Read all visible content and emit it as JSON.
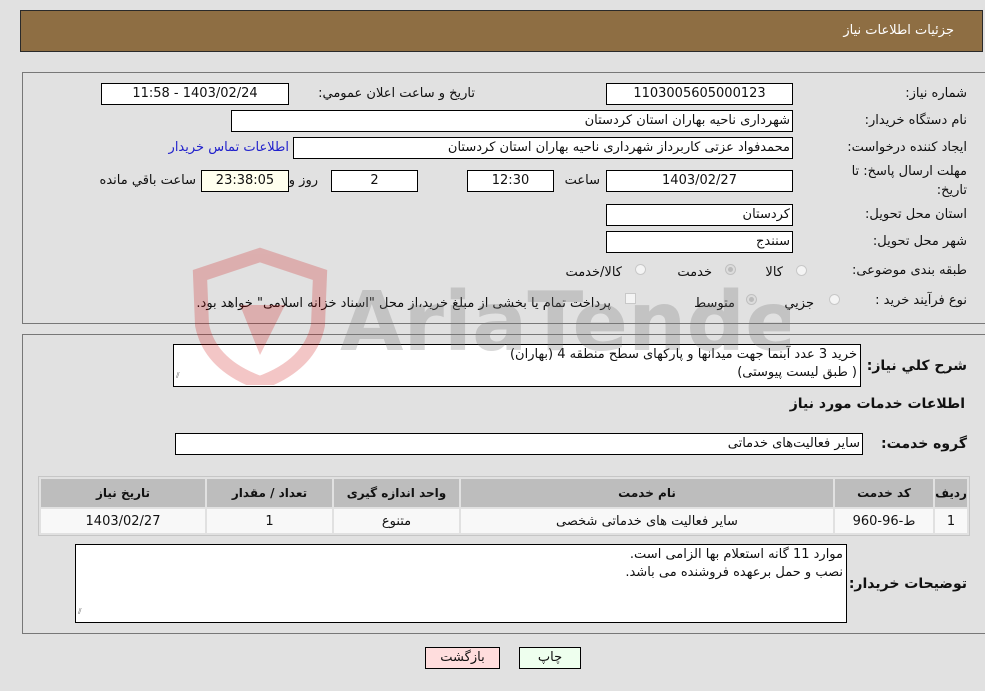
{
  "header": {
    "title": "جزئیات اطلاعات نیاز"
  },
  "fields": {
    "need_number_label": "شماره نیاز:",
    "need_number": "1103005605000123",
    "announce_label": "تاریخ و ساعت اعلان عمومي:",
    "announce_value": "1403/02/24 - 11:58",
    "buyer_org_label": "نام دستگاه خریدار:",
    "buyer_org": "شهرداری ناحیه بهاران استان کردستان",
    "creator_label": "ایجاد کننده درخواست:",
    "creator": "محمدفواد عزتی کاربرداز شهرداری ناحیه بهاران استان کردستان",
    "contact_link": "اطلاعات تماس خریدار",
    "deadline_label_1": "مهلت ارسال پاسخ: تا",
    "deadline_label_2": "تاریخ:",
    "deadline_date": "1403/02/27",
    "time_label": "ساعت",
    "deadline_time": "12:30",
    "days_value": "2",
    "days_label": "روز و",
    "remaining_time": "23:38:05",
    "remaining_label": "ساعت باقي مانده",
    "province_label": "استان محل تحویل:",
    "province": "کردستان",
    "city_label": "شهر محل تحویل:",
    "city": "سنندج",
    "category_label": "طبقه بندی موضوعی:",
    "category_options": [
      {
        "label": "کالا",
        "checked": false
      },
      {
        "label": "خدمت",
        "checked": true
      },
      {
        "label": "کالا/خدمت",
        "checked": false
      }
    ],
    "process_label": "نوع فرآیند خرید :",
    "process_options": [
      {
        "label": "جزيي",
        "checked": false
      },
      {
        "label": "متوسط",
        "checked": true
      }
    ],
    "treasury_note": "پرداخت تمام یا بخشی از مبلغ خرید،از محل \"اسناد خزانه اسلامی\" خواهد بود.",
    "treasury_checked": false
  },
  "description": {
    "label": "شرح کلي نیاز:",
    "line1": "خرید 3 عدد آبنما جهت میدانها و پارکهای سطح منطقه 4 (بهاران)",
    "line2": "( طبق لیست پیوستی)"
  },
  "services": {
    "section_title": "اطلاعات خدمات مورد نیاز",
    "group_label": "گروه خدمت:",
    "group_value": "سایر فعالیت‌های خدماتی",
    "table": {
      "headers": [
        "ردیف",
        "کد خدمت",
        "نام خدمت",
        "واحد اندازه گیری",
        "تعداد / مقدار",
        "تاریخ نیاز"
      ],
      "rows": [
        [
          "1",
          "ط-96-960",
          "سایر فعالیت های خدماتی شخصی",
          "متنوع",
          "1",
          "1403/02/27"
        ]
      ]
    }
  },
  "buyer_notes": {
    "label": "توضیحات خریدار:",
    "line1": "موارد 11 گانه استعلام بها الزامی است.",
    "line2": "نصب و حمل برعهده فروشنده می باشد."
  },
  "buttons": {
    "print": "چاپ",
    "back": "بازگشت"
  },
  "colors": {
    "header_bg": "#8e6e43",
    "print_bg": "#eeffee",
    "back_bg": "#ffdddd",
    "link": "#2222cc"
  },
  "watermark": "AriaTender.neT"
}
